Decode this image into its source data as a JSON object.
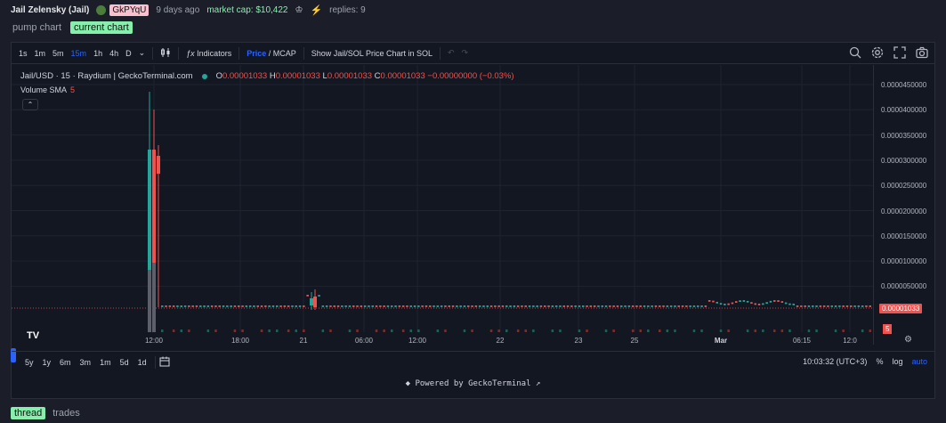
{
  "header": {
    "coin_name": "Jail Zelensky (Jail)",
    "creator_icon": "frog-avatar-icon",
    "creator": "GkPYqU",
    "time_ago": "9 days ago",
    "market_cap": "market cap: $10,422",
    "replies": "replies: 9"
  },
  "chart_tabs": [
    "pump chart",
    "current chart"
  ],
  "toolbar": {
    "intervals": [
      "1s",
      "1m",
      "5m",
      "15m",
      "1h",
      "4h",
      "D"
    ],
    "selected_interval": "15m",
    "indicators_label": "Indicators",
    "price_label": "Price",
    "mcap_label": "/ MCAP",
    "show_sol_label": "Show Jail/SOL Price Chart in SOL"
  },
  "legend": {
    "symbol": "Jail/USD · 15 · Raydium | GeckoTerminal.com",
    "o_key": "O",
    "o_val": "0.00001033",
    "h_key": "H",
    "h_val": "0.00001033",
    "l_key": "L",
    "l_val": "0.00001033",
    "c_key": "C",
    "c_val": "0.00001033",
    "change": "−0.00000000 (−0.03%)",
    "volume_label": "Volume SMA",
    "volume_n": "5"
  },
  "price_scale": {
    "ticks": [
      "0.0000450000",
      "0.0000400000",
      "0.0000350000",
      "0.0000300000",
      "0.0000250000",
      "0.0000200000",
      "0.0000150000",
      "0.0000100000",
      "0.0000050000"
    ],
    "current_price": "0.00001033",
    "volume_tag": "5"
  },
  "time_axis": [
    "12:00",
    "18:00",
    "21",
    "06:00",
    "12:00",
    "22",
    "23",
    "25",
    "Mar",
    "06:15",
    "12:0"
  ],
  "bottom_bar": {
    "ranges": [
      "5y",
      "1y",
      "6m",
      "3m",
      "1m",
      "5d",
      "1d"
    ],
    "clock": "10:03:32 (UTC+3)",
    "percent": "%",
    "log": "log",
    "auto": "auto"
  },
  "powered_by": "Powered by GeckoTerminal ↗",
  "bottom_tabs": [
    "thread",
    "trades"
  ],
  "colors": {
    "up": "#26a69a",
    "down": "#ef5350",
    "accent": "#2962ff",
    "tab_active": "#86efac"
  }
}
